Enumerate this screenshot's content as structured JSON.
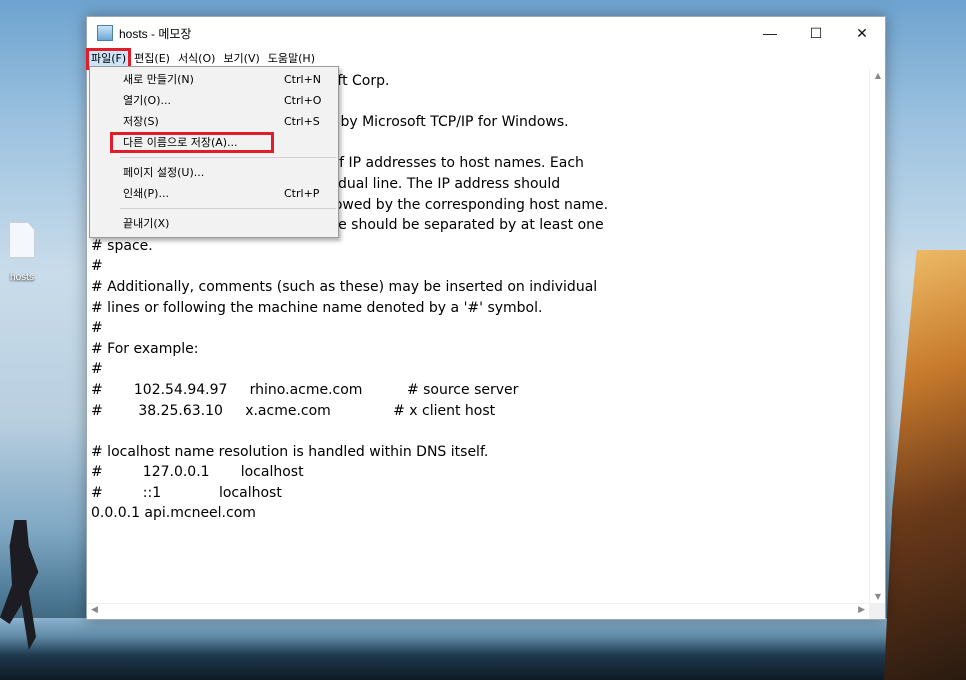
{
  "window": {
    "title": "hosts - 메모장",
    "controls": {
      "minimize": "—",
      "maximize": "☐",
      "close": "✕"
    }
  },
  "menubar": [
    {
      "label": "파일(F)"
    },
    {
      "label": "편집(E)"
    },
    {
      "label": "서식(O)"
    },
    {
      "label": "보기(V)"
    },
    {
      "label": "도움말(H)"
    }
  ],
  "file_menu": [
    {
      "label": "새로 만들기(N)",
      "shortcut": "Ctrl+N"
    },
    {
      "label": "열기(O)...",
      "shortcut": "Ctrl+O"
    },
    {
      "label": "저장(S)",
      "shortcut": "Ctrl+S"
    },
    {
      "label": "다른 이름으로 저장(A)...",
      "shortcut": ""
    },
    {
      "label": "페이지 설정(U)...",
      "shortcut": ""
    },
    {
      "label": "인쇄(P)...",
      "shortcut": "Ctrl+P"
    },
    {
      "label": "끝내기(X)",
      "shortcut": ""
    }
  ],
  "editor": {
    "text": "# Copyright (c) 1993-2009 Microsoft Corp.\n#\n# This is a sample HOSTS file used by Microsoft TCP/IP for Windows.\n#\n# This file contains the mappings of IP addresses to host names. Each\n# entry should be kept on an individual line. The IP address should\n# be placed in the first column followed by the corresponding host name.\n# The IP address and the host name should be separated by at least one\n# space.\n#\n# Additionally, comments (such as these) may be inserted on individual\n# lines or following the machine name denoted by a '#' symbol.\n#\n# For example:\n#\n#       102.54.94.97     rhino.acme.com          # source server\n#        38.25.63.10     x.acme.com              # x client host\n\n# localhost name resolution is handled within DNS itself.\n#         127.0.0.1       localhost\n#         ::1             localhost\n0.0.0.1 api.mcneel.com"
  },
  "desktop": {
    "icon_label": "hosts"
  },
  "colors": {
    "highlight_border": "#e21d2a",
    "menu_active_bg": "#cce4f7"
  }
}
